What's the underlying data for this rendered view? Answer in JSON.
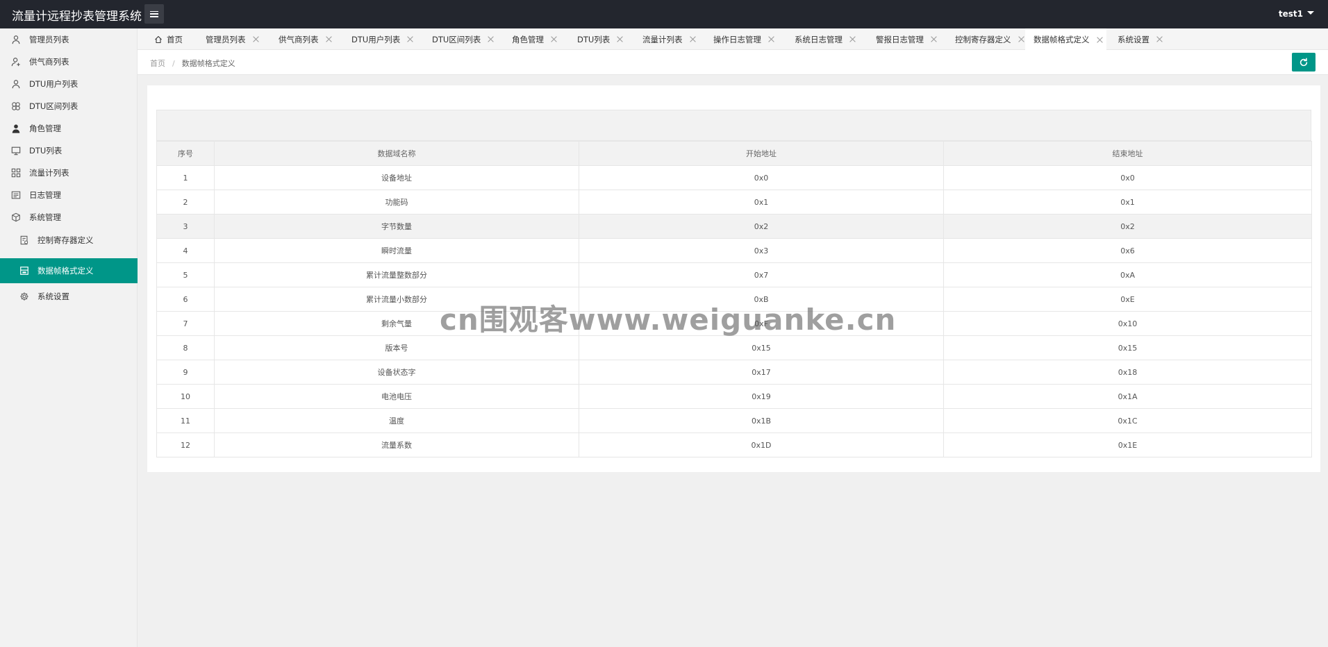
{
  "header": {
    "title": "流量计远程抄表管理系统",
    "user": "test1"
  },
  "sidebar": {
    "items": [
      {
        "label": "管理员列表",
        "icon": "user-icon"
      },
      {
        "label": "供气商列表",
        "icon": "user-add-icon"
      },
      {
        "label": "DTU用户列表",
        "icon": "user-icon"
      },
      {
        "label": "DTU区间列表",
        "icon": "flower-icon"
      },
      {
        "label": "角色管理",
        "icon": "person-solid-icon"
      },
      {
        "label": "DTU列表",
        "icon": "monitor-icon"
      },
      {
        "label": "流量计列表",
        "icon": "grid-icon"
      },
      {
        "label": "日志管理",
        "icon": "log-icon"
      },
      {
        "label": "系统管理",
        "icon": "cube-icon"
      },
      {
        "label": "控制寄存器定义",
        "icon": "register-icon"
      },
      {
        "label": "数据帧格式定义",
        "icon": "frame-icon"
      },
      {
        "label": "系统设置",
        "icon": "gear-icon"
      }
    ],
    "active_index": 10
  },
  "tabs": [
    {
      "label": "首页",
      "closable": false
    },
    {
      "label": "管理员列表",
      "closable": true
    },
    {
      "label": "供气商列表",
      "closable": true
    },
    {
      "label": "DTU用户列表",
      "closable": true
    },
    {
      "label": "DTU区间列表",
      "closable": true
    },
    {
      "label": "角色管理",
      "closable": true
    },
    {
      "label": "DTU列表",
      "closable": true
    },
    {
      "label": "流量计列表",
      "closable": true
    },
    {
      "label": "操作日志管理",
      "closable": true
    },
    {
      "label": "系统日志管理",
      "closable": true
    },
    {
      "label": "警报日志管理",
      "closable": true
    },
    {
      "label": "控制寄存器定义",
      "closable": true
    },
    {
      "label": "数据帧格式定义",
      "closable": true
    },
    {
      "label": "系统设置",
      "closable": true
    }
  ],
  "active_tab_index": 12,
  "breadcrumb": {
    "home": "首页",
    "separator": "/",
    "current": "数据帧格式定义"
  },
  "table": {
    "columns": [
      "序号",
      "数据域名称",
      "开始地址",
      "结束地址"
    ],
    "rows": [
      [
        "1",
        "设备地址",
        "0x0",
        "0x0"
      ],
      [
        "2",
        "功能码",
        "0x1",
        "0x1"
      ],
      [
        "3",
        "字节数量",
        "0x2",
        "0x2"
      ],
      [
        "4",
        "瞬时流量",
        "0x3",
        "0x6"
      ],
      [
        "5",
        "累计流量整数部分",
        "0x7",
        "0xA"
      ],
      [
        "6",
        "累计流量小数部分",
        "0xB",
        "0xE"
      ],
      [
        "7",
        "剩余气量",
        "0xF",
        "0x10"
      ],
      [
        "8",
        "版本号",
        "0x15",
        "0x15"
      ],
      [
        "9",
        "设备状态字",
        "0x17",
        "0x18"
      ],
      [
        "10",
        "电池电压",
        "0x19",
        "0x1A"
      ],
      [
        "11",
        "温度",
        "0x1B",
        "0x1C"
      ],
      [
        "12",
        "流量系数",
        "0x1D",
        "0x1E"
      ]
    ],
    "hover_row_index": 2
  },
  "watermark": "cn围观客www.weiguanke.cn",
  "colors": {
    "accent": "#009688",
    "header_bg": "#23262e",
    "sidebar_bg": "#f2f2f2"
  }
}
